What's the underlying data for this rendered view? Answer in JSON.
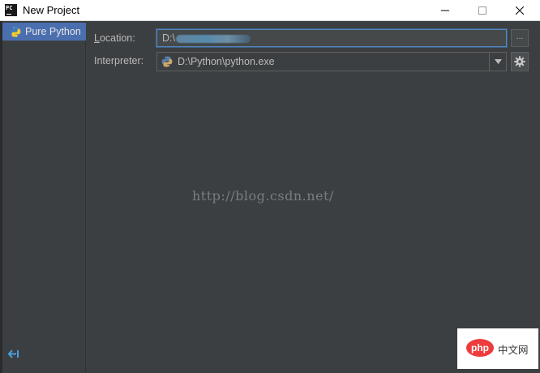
{
  "window": {
    "title": "New Project",
    "app_icon_text": "PC"
  },
  "sidebar": {
    "items": [
      {
        "label": "Pure Python",
        "icon": "python-icon",
        "selected": true
      }
    ],
    "back_icon": "back-arrow-icon"
  },
  "form": {
    "location": {
      "label_mnemonic": "L",
      "label_rest": "ocation:",
      "value": "D:\\"
    },
    "interpreter": {
      "label": "Interpreter:",
      "value": "D:\\Python\\python.exe"
    },
    "browse_label": "..."
  },
  "watermark": "http://blog.csdn.net/",
  "badge": {
    "logo": "php",
    "text": "中文网"
  },
  "colors": {
    "selection": "#4b6eaf",
    "background": "#3c3f41",
    "focus_border": "#5588c2"
  }
}
